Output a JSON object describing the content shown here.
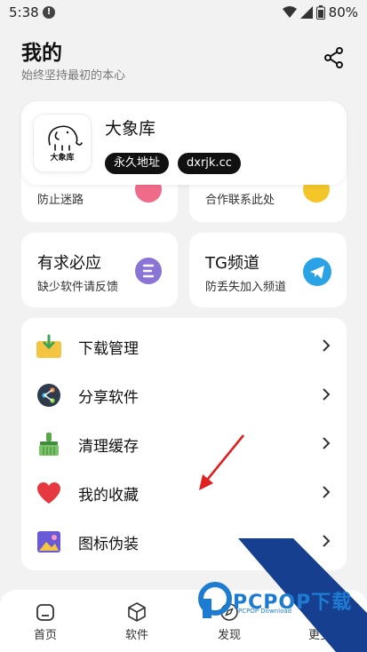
{
  "status_bar": {
    "time": "5:38",
    "battery": "80%"
  },
  "header": {
    "title": "我的",
    "subtitle": "始终坚持最初的本心"
  },
  "profile": {
    "name": "大象库",
    "logo_text": "大象库",
    "tags": [
      "永久地址",
      "dxrjk.cc"
    ]
  },
  "tiles": [
    {
      "id": "lost",
      "title": "",
      "subtitle": "防止迷路"
    },
    {
      "id": "contact",
      "title": "",
      "subtitle": "合作联系此处"
    },
    {
      "id": "request",
      "title": "有求必应",
      "subtitle": "缺少软件请反馈"
    },
    {
      "id": "tg",
      "title": "TG频道",
      "subtitle": "防丢失加入频道"
    }
  ],
  "menu": [
    {
      "label": "下载管理",
      "icon": "download-folder-icon"
    },
    {
      "label": "分享软件",
      "icon": "share-icon"
    },
    {
      "label": "清理缓存",
      "icon": "broom-icon"
    },
    {
      "label": "我的收藏",
      "icon": "heart-icon"
    },
    {
      "label": "图标伪装",
      "icon": "picture-icon"
    }
  ],
  "nav": [
    {
      "label": "首页",
      "icon": "home-icon"
    },
    {
      "label": "软件",
      "icon": "box-icon"
    },
    {
      "label": "发现",
      "icon": "compass-icon"
    },
    {
      "label": "更多",
      "icon": "more-icon"
    }
  ],
  "watermark": {
    "brand": "PCPOP下载",
    "sub": "PCPOP Download"
  },
  "colors": {
    "accent_blue": "#1e7bd2",
    "telegram": "#2aa3e6",
    "pill": "#111111",
    "heart": "#e5393f"
  }
}
